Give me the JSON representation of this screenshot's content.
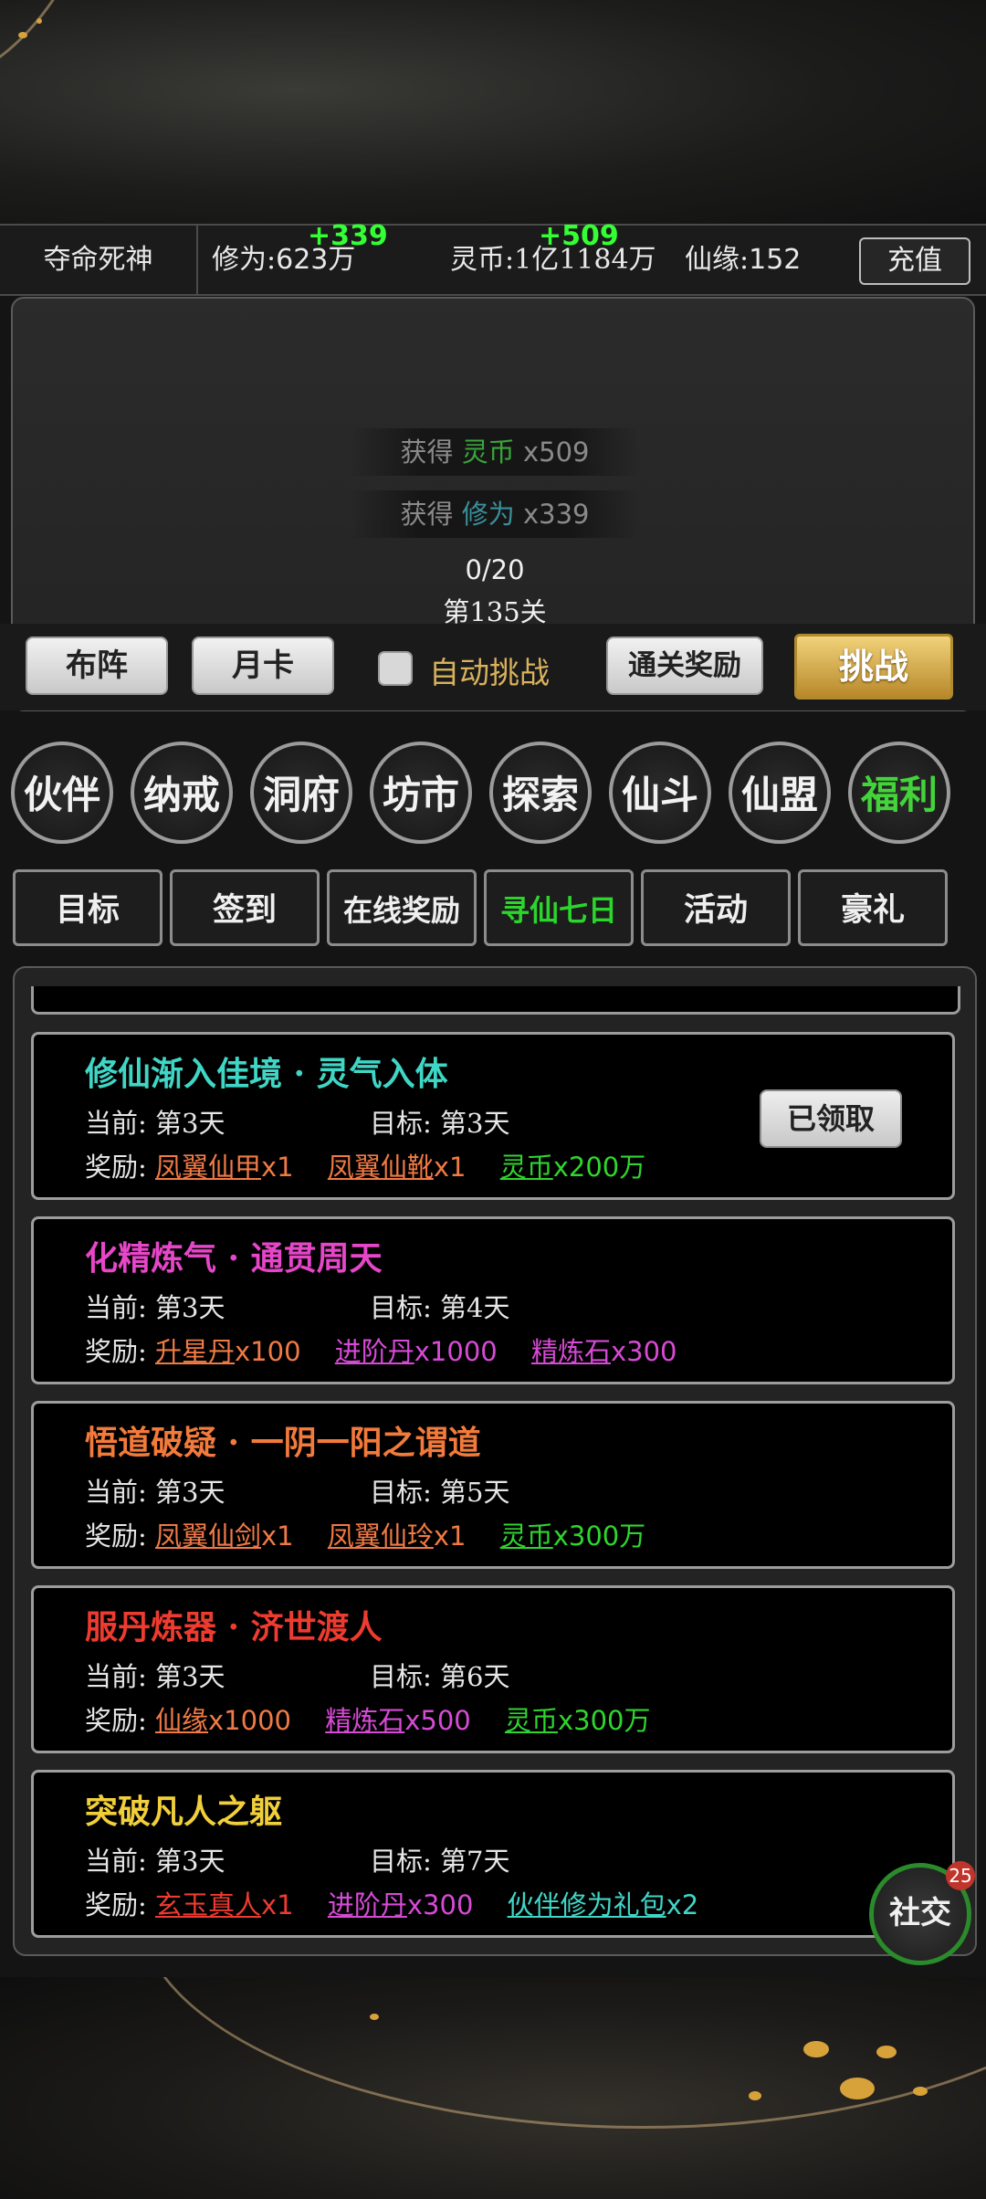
{
  "status_bar": {
    "player_name": "夺命死神",
    "cultivation_label": "修为:",
    "cultivation_value": "623万",
    "cultivation_gain": "+339",
    "coins_label": "灵币:",
    "coins_value": "1亿1184万",
    "coins_gain": "+509",
    "fate_label": "仙缘:",
    "fate_value": "152",
    "recharge_label": "充值"
  },
  "battle": {
    "loot": [
      {
        "prefix": "获得",
        "item": "灵币",
        "qty": "x509"
      },
      {
        "prefix": "获得",
        "item": "修为",
        "qty": "x339"
      }
    ],
    "progress": "0/20",
    "stage": "第135关"
  },
  "action_bar": {
    "formation_label": "布阵",
    "monthly_card_label": "月卡",
    "auto_challenge_label": "自动挑战",
    "clear_reward_label": "通关奖励",
    "challenge_label": "挑战"
  },
  "main_menu": [
    {
      "label": "伙伴"
    },
    {
      "label": "纳戒"
    },
    {
      "label": "洞府"
    },
    {
      "label": "坊市"
    },
    {
      "label": "探索"
    },
    {
      "label": "仙斗"
    },
    {
      "label": "仙盟"
    },
    {
      "label": "福利",
      "active": true
    }
  ],
  "tabs": [
    {
      "label": "目标"
    },
    {
      "label": "签到"
    },
    {
      "label": "在线奖励"
    },
    {
      "label": "寻仙七日",
      "active": true
    },
    {
      "label": "活动"
    },
    {
      "label": "豪礼"
    }
  ],
  "labels": {
    "current": "当前:",
    "target": "目标:",
    "reward": "奖励:"
  },
  "quests": [
    {
      "title": "修仙渐入佳境 · 灵气入体",
      "title_color": "#3fd6c6",
      "current": "第3天",
      "target": "第3天",
      "claim_label": "已领取",
      "rewards": [
        {
          "name": "凤翼仙甲",
          "qty": "x1",
          "color": "#f07a45"
        },
        {
          "name": "凤翼仙靴",
          "qty": "x1",
          "color": "#f07a45"
        },
        {
          "name": "灵币",
          "qty": "x200万",
          "color": "#2fd52f"
        }
      ]
    },
    {
      "title": "化精炼气 · 通贯周天",
      "title_color": "#e646c8",
      "current": "第3天",
      "target": "第4天",
      "rewards": [
        {
          "name": "升星丹",
          "qty": "x100",
          "color": "#f07a45"
        },
        {
          "name": "进阶丹",
          "qty": "x1000",
          "color": "#d74ad6"
        },
        {
          "name": "精炼石",
          "qty": "x300",
          "color": "#d74ad6"
        }
      ]
    },
    {
      "title": "悟道破疑 · 一阴一阳之谓道",
      "title_color": "#f27a3b",
      "current": "第3天",
      "target": "第5天",
      "rewards": [
        {
          "name": "凤翼仙剑",
          "qty": "x1",
          "color": "#f07a45"
        },
        {
          "name": "凤翼仙玲",
          "qty": "x1",
          "color": "#f07a45"
        },
        {
          "name": "灵币",
          "qty": "x300万",
          "color": "#2fd52f"
        }
      ]
    },
    {
      "title": "服丹炼器 · 济世渡人",
      "title_color": "#ee3b30",
      "current": "第3天",
      "target": "第6天",
      "rewards": [
        {
          "name": "仙缘",
          "qty": "x1000",
          "color": "#f07a45"
        },
        {
          "name": "精炼石",
          "qty": "x500",
          "color": "#d74ad6"
        },
        {
          "name": "灵币",
          "qty": "x300万",
          "color": "#2fd52f"
        }
      ]
    },
    {
      "title": "突破凡人之躯",
      "title_color": "#f1cf3b",
      "current": "第3天",
      "target": "第7天",
      "rewards": [
        {
          "name": "玄玉真人",
          "qty": "x1",
          "color": "#ee3b30"
        },
        {
          "name": "进阶丹",
          "qty": "x300",
          "color": "#d74ad6"
        },
        {
          "name": "伙伴修为礼包",
          "qty": "x2",
          "color": "#3fd6c6"
        }
      ]
    }
  ],
  "social": {
    "label": "社交",
    "badge": "25"
  },
  "colors": {
    "accent_green": "#2cd52c",
    "gold_button": "#d8b25c"
  }
}
